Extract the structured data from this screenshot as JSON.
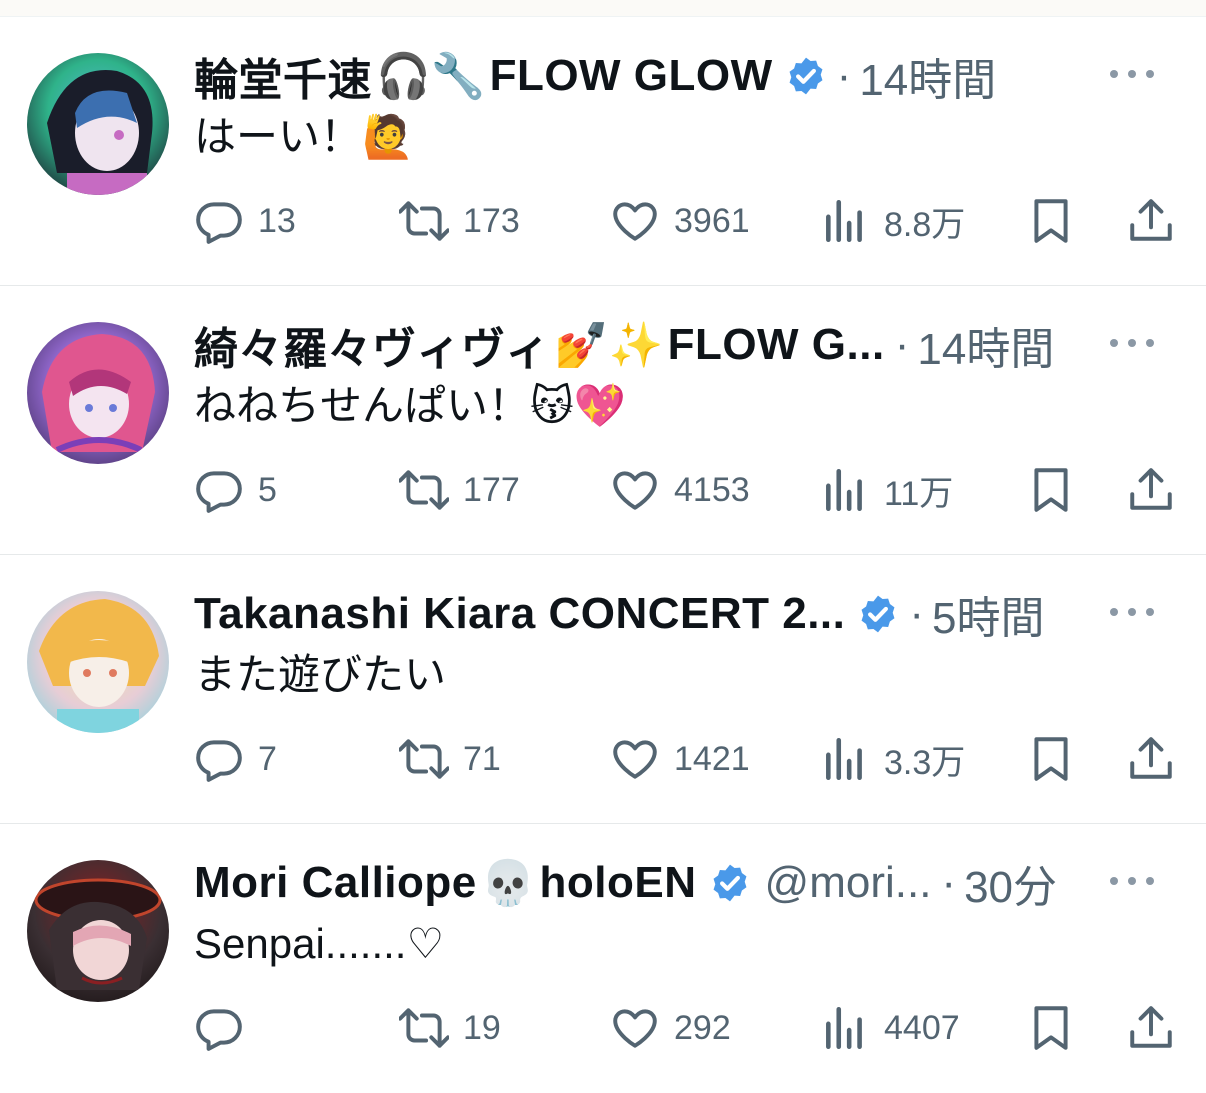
{
  "tweets": [
    {
      "name": "輪堂千速",
      "name_emoji": "🎧🔧",
      "name_suffix": "FLOW GLOW",
      "verified": true,
      "handle": "",
      "dot": "·",
      "time": "14時間",
      "text": "はーい！🙋",
      "replies": "13",
      "retweets": "173",
      "likes": "3961",
      "views": "8.8万",
      "avatar_colors": [
        "#1a1d2a",
        "#2fb38a",
        "#5ab6d6",
        "#c66bc2"
      ]
    },
    {
      "name": "綺々羅々ヴィヴィ",
      "name_emoji": "💅✨",
      "name_suffix": "FLOW G...",
      "verified": false,
      "handle": "",
      "dot": "·",
      "time": "14時間",
      "text": "ねねちせんぱい！😽💖",
      "replies": "5",
      "retweets": "177",
      "likes": "4153",
      "views": "11万",
      "avatar_colors": [
        "#3c2a5a",
        "#e0568f",
        "#9a6ed8",
        "#f2d7ea"
      ]
    },
    {
      "name": "Takanashi Kiara CONCERT 2...",
      "name_emoji": "",
      "name_suffix": "",
      "verified": true,
      "handle": "",
      "dot": "·",
      "time": "5時間",
      "text": "また遊びたい",
      "replies": "7",
      "retweets": "71",
      "likes": "1421",
      "views": "3.3万",
      "avatar_colors": [
        "#f3e7a4",
        "#f2b84b",
        "#7fd4df",
        "#e7cdd6"
      ]
    },
    {
      "name": "Mori Calliope",
      "name_emoji": "💀",
      "name_suffix": "holoEN",
      "verified": true,
      "handle": "@mori...",
      "dot": "·",
      "time": "30分",
      "text": "Senpai.......♡",
      "replies": "",
      "retweets": "19",
      "likes": "292",
      "views": "4407",
      "avatar_colors": [
        "#1b1415",
        "#8a1f22",
        "#e3a6b4",
        "#3a2f33"
      ]
    }
  ],
  "icons": {
    "reply": "reply-icon",
    "retweet": "retweet-icon",
    "like": "heart-icon",
    "views": "views-icon",
    "bookmark": "bookmark-icon",
    "share": "share-icon",
    "more": "more-icon",
    "verified": "verified-badge-icon"
  },
  "colors": {
    "verified": "#4a99e9",
    "muted": "#536471",
    "text": "#0f1419"
  }
}
